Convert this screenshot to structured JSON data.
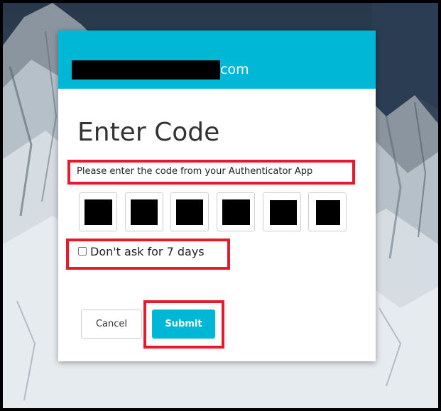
{
  "header": {
    "domain_suffix": "com"
  },
  "dialog": {
    "title": "Enter Code",
    "instruction": "Please enter the code from your Authenticator App",
    "code_digits": 6,
    "remember_label": "Don't ask for 7 days",
    "remember_checked": false,
    "cancel_label": "Cancel",
    "submit_label": "Submit"
  },
  "colors": {
    "accent": "#00b8d6",
    "highlight": "#e8192c"
  },
  "icons": {
    "checkbox": "checkbox-unchecked-icon"
  }
}
